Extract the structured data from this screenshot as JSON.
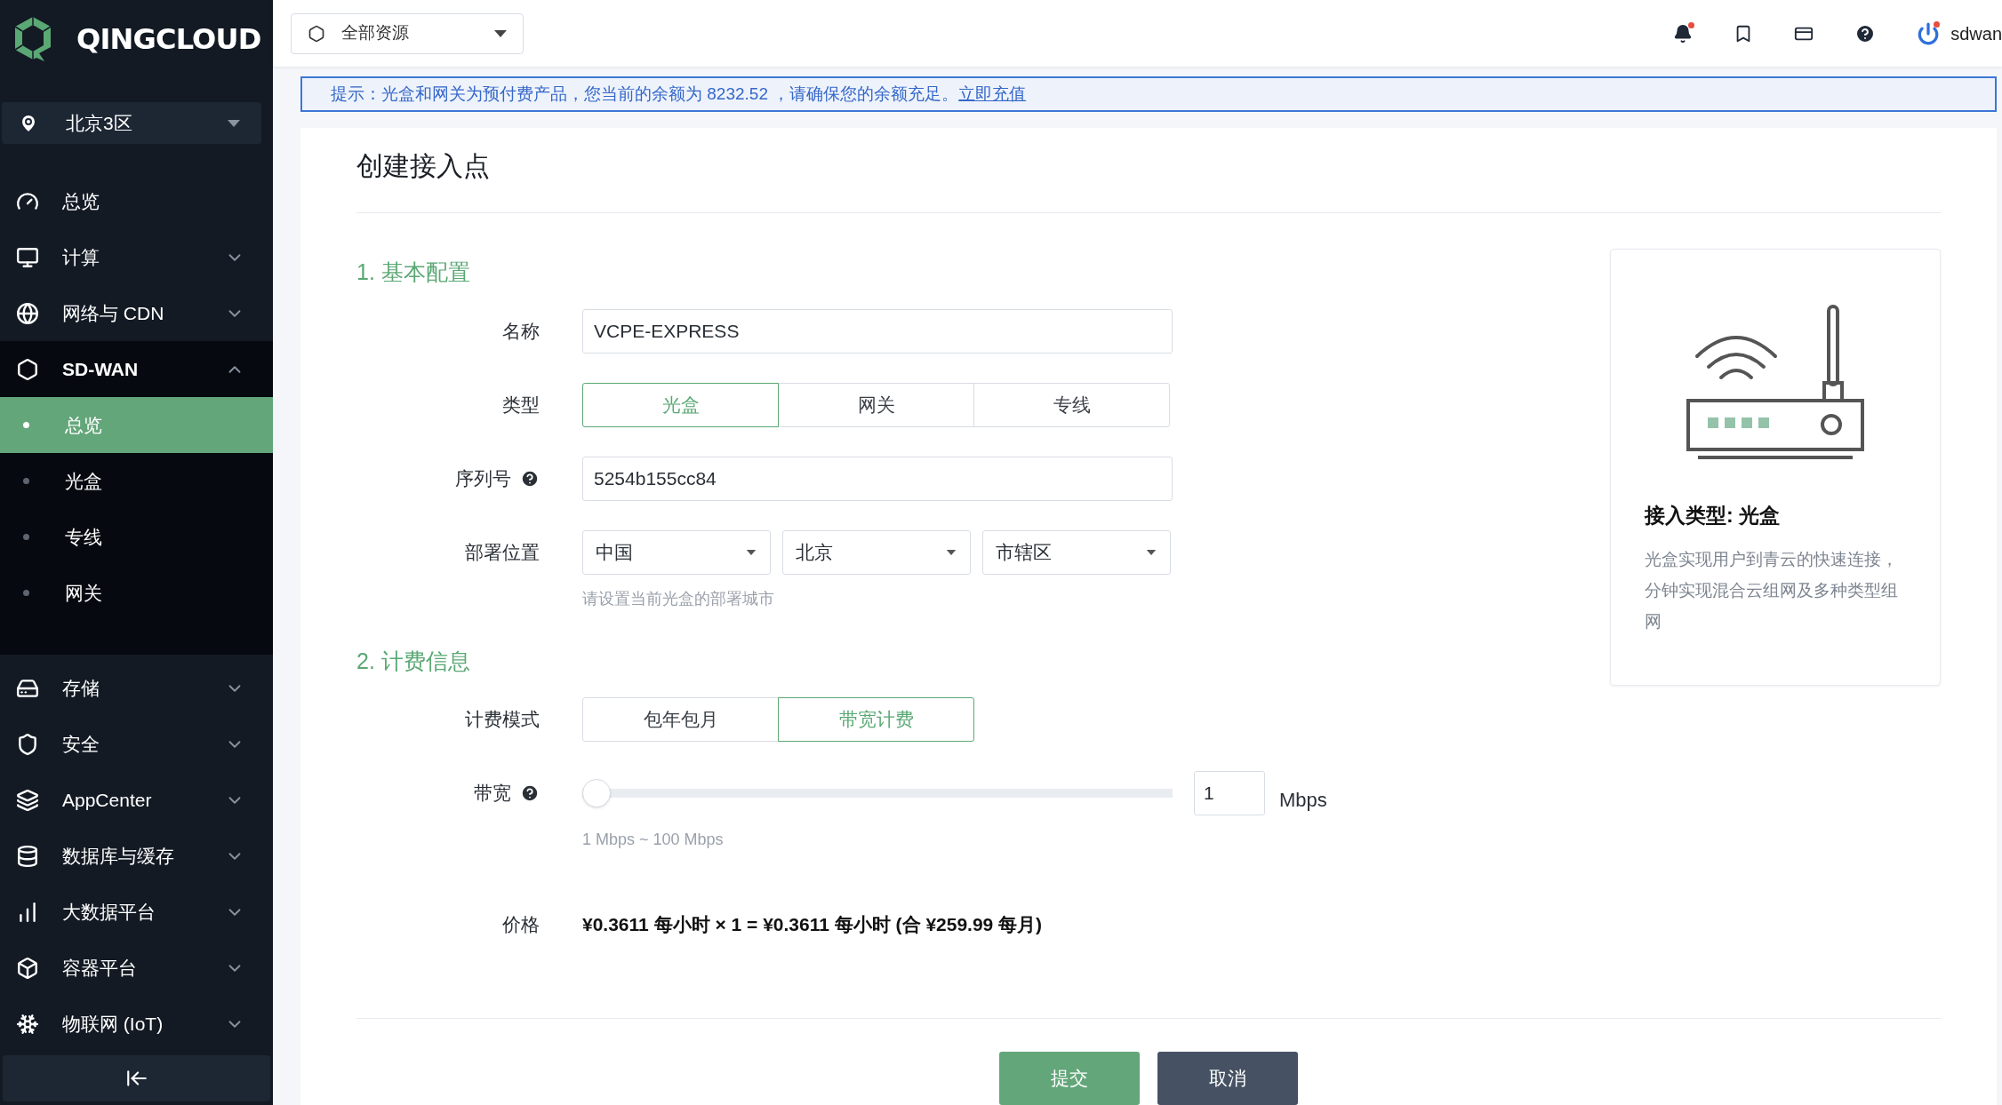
{
  "sidebar": {
    "brand": "QINGCLOUD",
    "region": "北京3区",
    "items": [
      {
        "label": "总览"
      },
      {
        "label": "计算",
        "expanded": false
      },
      {
        "label": "网络与 CDN",
        "expanded": false
      },
      {
        "label": "SD-WAN",
        "expanded": true,
        "children": [
          {
            "label": "总览",
            "selected": true
          },
          {
            "label": "光盒",
            "selected": false
          },
          {
            "label": "专线",
            "selected": false
          },
          {
            "label": "网关",
            "selected": false
          }
        ]
      },
      {
        "label": "存储",
        "expanded": false
      },
      {
        "label": "安全",
        "expanded": false
      },
      {
        "label": "AppCenter",
        "expanded": false
      },
      {
        "label": "数据库与缓存",
        "expanded": false
      },
      {
        "label": "大数据平台",
        "expanded": false
      },
      {
        "label": "容器平台",
        "expanded": false
      },
      {
        "label": "物联网 (IoT)",
        "expanded": false
      }
    ]
  },
  "header": {
    "resource_selector": "全部资源",
    "notifications": {
      "alert": true
    },
    "user": {
      "name": "sdwan",
      "alert": true
    }
  },
  "banner": {
    "text": "提示：光盒和网关为预付费产品，您当前的余额为 8232.52 ，请确保您的余额充足。",
    "link": "立即充值"
  },
  "form": {
    "title": "创建接入点",
    "sections": [
      {
        "heading": "1. 基本配置",
        "fields": [
          {
            "kind": "text",
            "label": "名称",
            "value": "VCPE-EXPRESS",
            "help": false
          },
          {
            "kind": "segmented",
            "label": "类型",
            "options": [
              {
                "label": "光盒",
                "selected": true
              },
              {
                "label": "网关",
                "selected": false
              },
              {
                "label": "专线",
                "selected": false
              }
            ]
          },
          {
            "kind": "text",
            "label": "序列号",
            "value": "5254b155cc84",
            "help": true
          },
          {
            "kind": "selects",
            "label": "部署位置",
            "selects": [
              "中国",
              "北京",
              "市辖区"
            ],
            "hint": "请设置当前光盒的部署城市"
          }
        ]
      },
      {
        "heading": "2. 计费信息",
        "fields": [
          {
            "kind": "segmented",
            "label": "计费模式",
            "options": [
              {
                "label": "包年包月",
                "selected": false
              },
              {
                "label": "带宽计费",
                "selected": true
              }
            ]
          },
          {
            "kind": "slider",
            "label": "带宽",
            "help": true,
            "level": 0,
            "value": "1",
            "unit": "Mbps",
            "hint": "1 Mbps ~ 100 Mbps"
          },
          {
            "kind": "price",
            "label": "价格",
            "value": "¥0.3611 每小时 × 1 = ¥0.3611 每小时 (合 ¥259.99 每月)"
          }
        ]
      }
    ],
    "buttons": [
      {
        "label": "提交",
        "kind": "primary"
      },
      {
        "label": "取消",
        "kind": "secondary"
      }
    ]
  },
  "info_card": {
    "title": "接入类型: 光盒",
    "description": "光盒实现用户到青云的快速连接，分钟实现混合云组网及多种类型组网"
  }
}
